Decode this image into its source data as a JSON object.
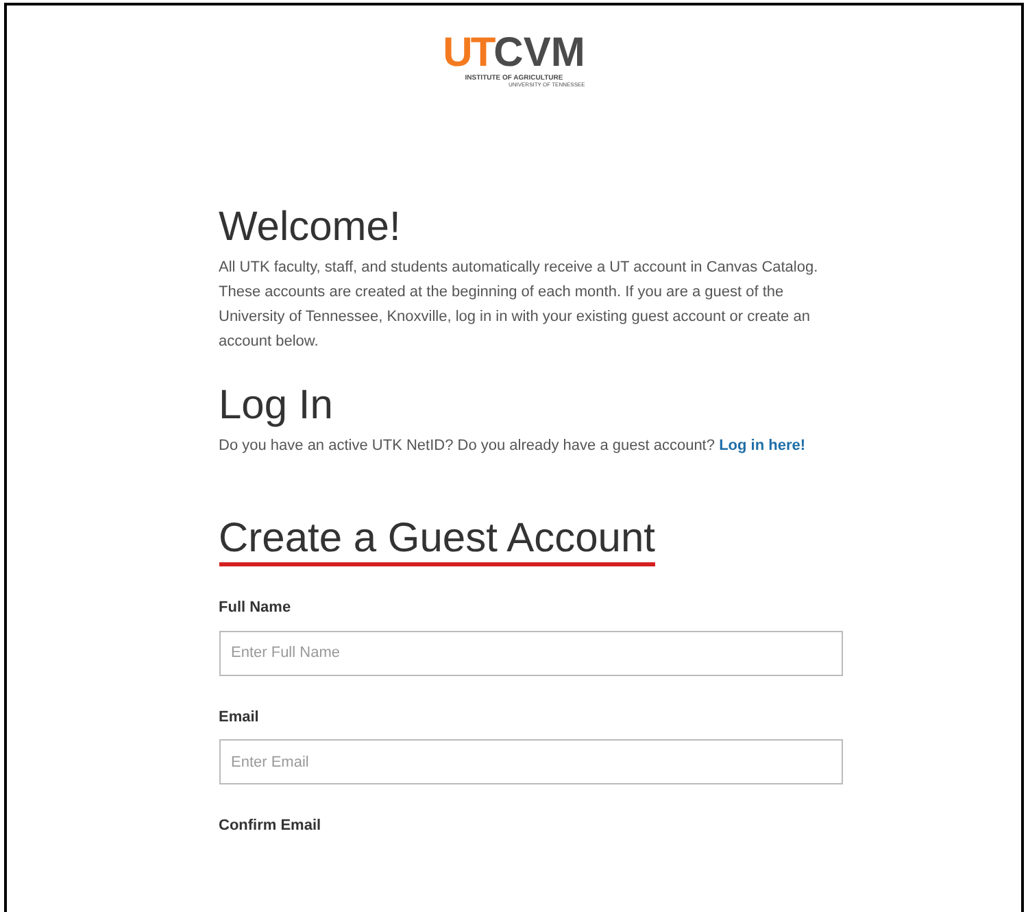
{
  "logo": {
    "mark": "UT",
    "name": "CVM",
    "line_1": "INSTITUTE OF AGRICULTURE",
    "line_2": "UNIVERSITY OF TENNESSEE"
  },
  "welcome": {
    "title": "Welcome!",
    "text": "All UTK faculty, staff, and students automatically receive a UT account in Canvas Catalog. These accounts are created at the beginning of each month. If you are a guest of the University of Tennessee, Knoxville, log in in with your existing guest account or create an account below."
  },
  "login": {
    "title": "Log In",
    "text": "Do you have an active UTK NetID? Do you already have a guest account?",
    "link": "Log in here!"
  },
  "create": {
    "title": "Create a Guest Account",
    "underlined": true
  },
  "fields": [
    {
      "label": "Full Name",
      "placeholder": "Enter Full Name"
    },
    {
      "label": "Email",
      "placeholder": "Enter Email"
    },
    {
      "label": "Confirm Email"
    }
  ]
}
